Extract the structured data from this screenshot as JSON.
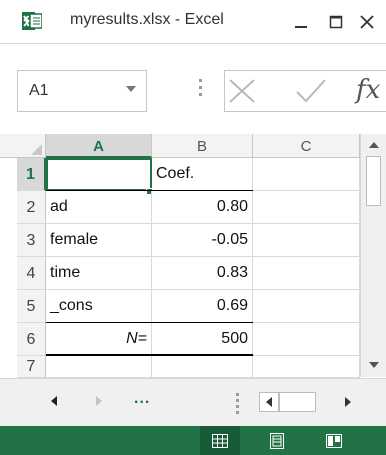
{
  "window": {
    "title": "myresults.xlsx - Excel",
    "app_icon": "excel-icon",
    "controls": [
      "minimize-icon",
      "maximize-icon",
      "close-icon"
    ]
  },
  "formula_bar": {
    "name_box": "A1",
    "fx_label": "fx",
    "formula": ""
  },
  "grid": {
    "columns": [
      "A",
      "B",
      "C"
    ],
    "selected_column": "A",
    "selected_row": "1",
    "rows": [
      {
        "num": "1",
        "a": "",
        "b": "Coef.",
        "c": ""
      },
      {
        "num": "2",
        "a": "ad",
        "b": "0.80",
        "c": ""
      },
      {
        "num": "3",
        "a": "female",
        "b": "-0.05",
        "c": ""
      },
      {
        "num": "4",
        "a": "time",
        "b": "0.83",
        "c": ""
      },
      {
        "num": "5",
        "a": "_cons",
        "b": "0.69",
        "c": ""
      },
      {
        "num": "6",
        "a": "N=",
        "b": "500",
        "c": ""
      },
      {
        "num": "7",
        "a": "",
        "b": "",
        "c": ""
      }
    ]
  },
  "sheet_nav": {
    "more": "..."
  },
  "status_bar": {
    "views": [
      "normal-view-icon",
      "page-layout-icon",
      "page-break-preview-icon"
    ],
    "active_view": "normal",
    "accent": "#217346"
  }
}
